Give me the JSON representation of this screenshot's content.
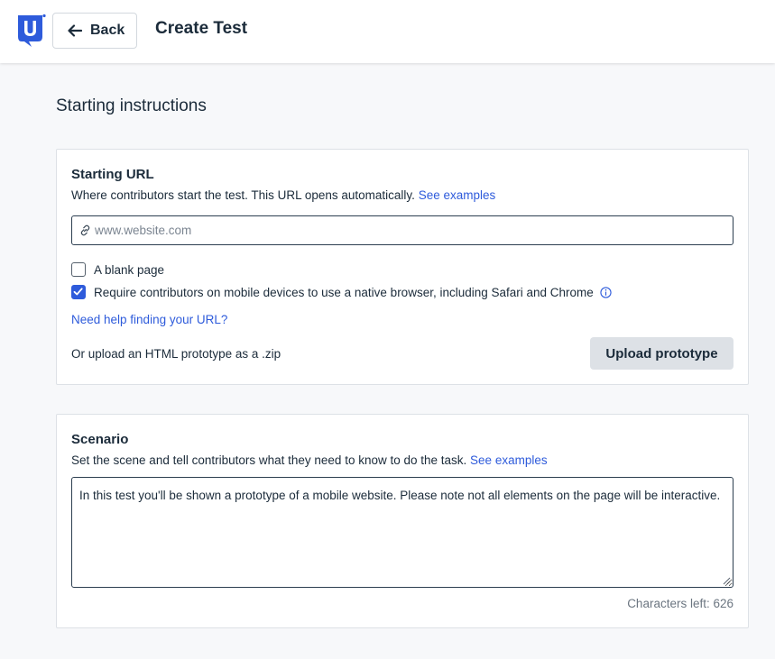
{
  "header": {
    "back_label": "Back",
    "title": "Create Test",
    "logo_letter": "U"
  },
  "main": {
    "section_title": "Starting instructions"
  },
  "starting_url": {
    "title": "Starting URL",
    "description": "Where contributors start the test. This URL opens automatically.",
    "examples_link": "See examples",
    "url_placeholder": "www.website.com",
    "url_value": "",
    "blank_page_label": "A blank page",
    "blank_page_checked": false,
    "native_browser_label": "Require contributors on mobile devices to use a native browser, including Safari and Chrome",
    "native_browser_checked": true,
    "help_link": "Need help finding your URL?",
    "upload_label": "Or upload an HTML prototype as a .zip",
    "upload_button": "Upload prototype"
  },
  "scenario": {
    "title": "Scenario",
    "description": "Set the scene and tell contributors what they need to know to do the task.",
    "examples_link": "See examples",
    "text": "In this test you'll be shown a prototype of a mobile website. Please note not all elements on the page will be interactive.",
    "chars_left": "Characters left: 626"
  },
  "colors": {
    "accent": "#2e5bdb",
    "text": "#1b2b3a",
    "button_bg": "#dde1e6"
  },
  "icons": [
    "usertesting-logo",
    "arrow-left-icon",
    "link-icon",
    "checkmark-icon",
    "info-icon"
  ]
}
